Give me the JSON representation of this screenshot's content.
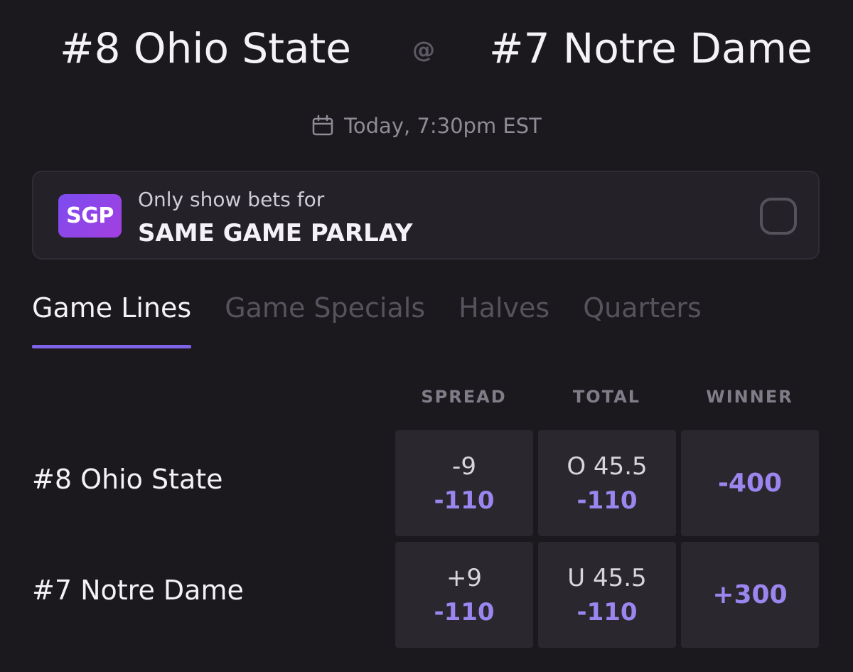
{
  "matchup": {
    "away_team": "#8 Ohio State",
    "at": "@",
    "home_team": "#7 Notre Dame",
    "datetime": "Today, 7:30pm EST"
  },
  "sgp": {
    "badge": "SGP",
    "label_top": "Only show bets for",
    "label_main": "SAME GAME PARLAY",
    "checked": false
  },
  "tabs": [
    {
      "label": "Game Lines",
      "active": true
    },
    {
      "label": "Game Specials",
      "active": false
    },
    {
      "label": "Halves",
      "active": false
    },
    {
      "label": "Quarters",
      "active": false
    }
  ],
  "columns": [
    "SPREAD",
    "TOTAL",
    "WINNER"
  ],
  "rows": [
    {
      "team": "#8 Ohio State",
      "spread": {
        "line": "-9",
        "price": "-110"
      },
      "total": {
        "line": "O 45.5",
        "price": "-110"
      },
      "winner": {
        "price": "-400"
      }
    },
    {
      "team": "#7 Notre Dame",
      "spread": {
        "line": "+9",
        "price": "-110"
      },
      "total": {
        "line": "U 45.5",
        "price": "-110"
      },
      "winner": {
        "price": "+300"
      }
    }
  ],
  "colors": {
    "background": "#1b191e",
    "accent": "#9b86f0",
    "tab_underline": "#7d63e6",
    "sgp_gradient_start": "#7b4cf0",
    "sgp_gradient_end": "#a43fe0"
  }
}
